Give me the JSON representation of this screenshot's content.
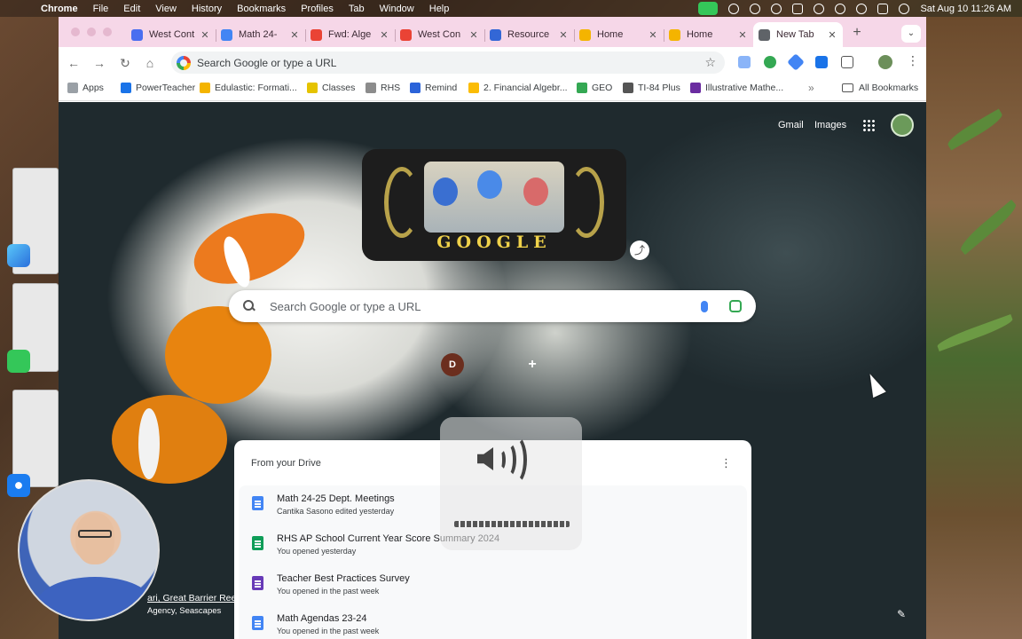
{
  "menubar": {
    "app": "Chrome",
    "items": [
      "File",
      "Edit",
      "View",
      "History",
      "Bookmarks",
      "Profiles",
      "Tab",
      "Window",
      "Help"
    ],
    "datetime": "Sat Aug 10  11:26 AM"
  },
  "tabs": [
    {
      "label": "West Cont",
      "color": "#4a6ef0"
    },
    {
      "label": "Math 24-",
      "color": "#4285f4"
    },
    {
      "label": "Fwd: Alge",
      "color": "#ea4335"
    },
    {
      "label": "West Con",
      "color": "#ea4335"
    },
    {
      "label": "Resource",
      "color": "#3367d6"
    },
    {
      "label": "Home",
      "color": "#f4b400"
    },
    {
      "label": "Home",
      "color": "#f4b400"
    },
    {
      "label": "New Tab",
      "color": "#5f6368"
    }
  ],
  "omnibox": {
    "placeholder": "Search Google or type a URL"
  },
  "bookmarks": [
    {
      "label": "Apps",
      "color": "#9aa0a6"
    },
    {
      "label": "PowerTeacher",
      "color": "#1a73e8"
    },
    {
      "label": "Edulastic: Formati...",
      "color": "#f4b400"
    },
    {
      "label": "Classes",
      "color": "#e5c300"
    },
    {
      "label": "RHS",
      "color": "#8c8c8c"
    },
    {
      "label": "Remind",
      "color": "#2b63d9"
    },
    {
      "label": "2. Financial Algebr...",
      "color": "#fbbc05"
    },
    {
      "label": "GEO",
      "color": "#34a853"
    },
    {
      "label": "TI-84 Plus",
      "color": "#555555"
    },
    {
      "label": "Illustrative Mathe...",
      "color": "#6a2ca0"
    }
  ],
  "bookmarks_all": "All Bookmarks",
  "ntp": {
    "gmail": "Gmail",
    "images": "Images",
    "doodle_text": "GOOGLE",
    "search_placeholder": "Search Google or type a URL",
    "shortcut_initial": "D",
    "shortcut_add_icon": "+",
    "drive_header": "From your Drive",
    "drive_items": [
      {
        "title": "Math 24-25 Dept. Meetings",
        "sub": "Cantika Sasono edited yesterday",
        "color": "#4285f4"
      },
      {
        "title": "RHS AP School Current Year Score Summary 2024",
        "sub": "You opened yesterday",
        "color": "#0f9d58"
      },
      {
        "title": "Teacher Best Practices Survey",
        "sub": "You opened in the past week",
        "color": "#673ab7"
      },
      {
        "title": "Math Agendas 23-24",
        "sub": "You opened in the past week",
        "color": "#4285f4"
      }
    ],
    "credit_line1": "ari, Great Barrier Ree",
    "credit_line2": "Agency, Seascapes"
  }
}
